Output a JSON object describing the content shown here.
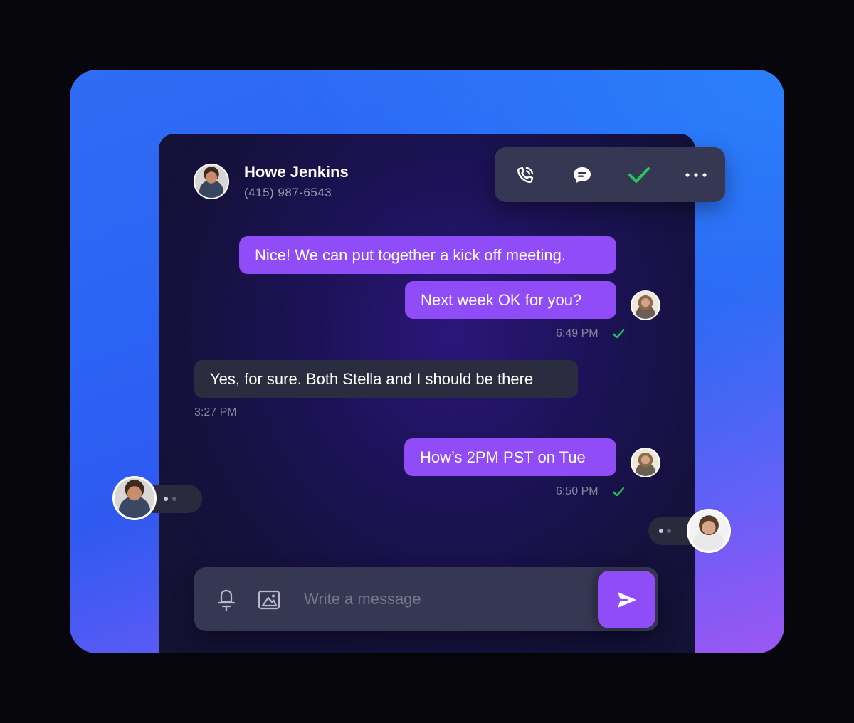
{
  "contact": {
    "name": "Howe Jenkins",
    "phone": "(415) 987-6543",
    "avatar": "man-avatar"
  },
  "toolbar": {
    "items": [
      {
        "icon": "phone-call-icon"
      },
      {
        "icon": "chat-bubble-icon"
      },
      {
        "icon": "checkmark-icon",
        "color": "#22c55e"
      },
      {
        "icon": "more-options-icon"
      }
    ]
  },
  "messages": [
    {
      "direction": "outgoing",
      "text": "Nice! We can put together a kick off meeting."
    },
    {
      "direction": "outgoing",
      "text": "Next week OK for you?",
      "time": "6:49 PM",
      "read": true
    },
    {
      "direction": "incoming",
      "text": "Yes, for sure. Both Stella and I should be there",
      "time": "3:27 PM"
    },
    {
      "direction": "outgoing",
      "text": "How’s 2PM PST on Tue",
      "time": "6:50 PM",
      "read": true
    }
  ],
  "composer": {
    "placeholder": "Write a message",
    "mic_icon": "microphone-icon",
    "image_icon": "image-icon",
    "send_icon": "send-icon"
  },
  "colors": {
    "accent": "#8f4cf7",
    "read_check": "#22c55e",
    "panel": "#363752"
  }
}
